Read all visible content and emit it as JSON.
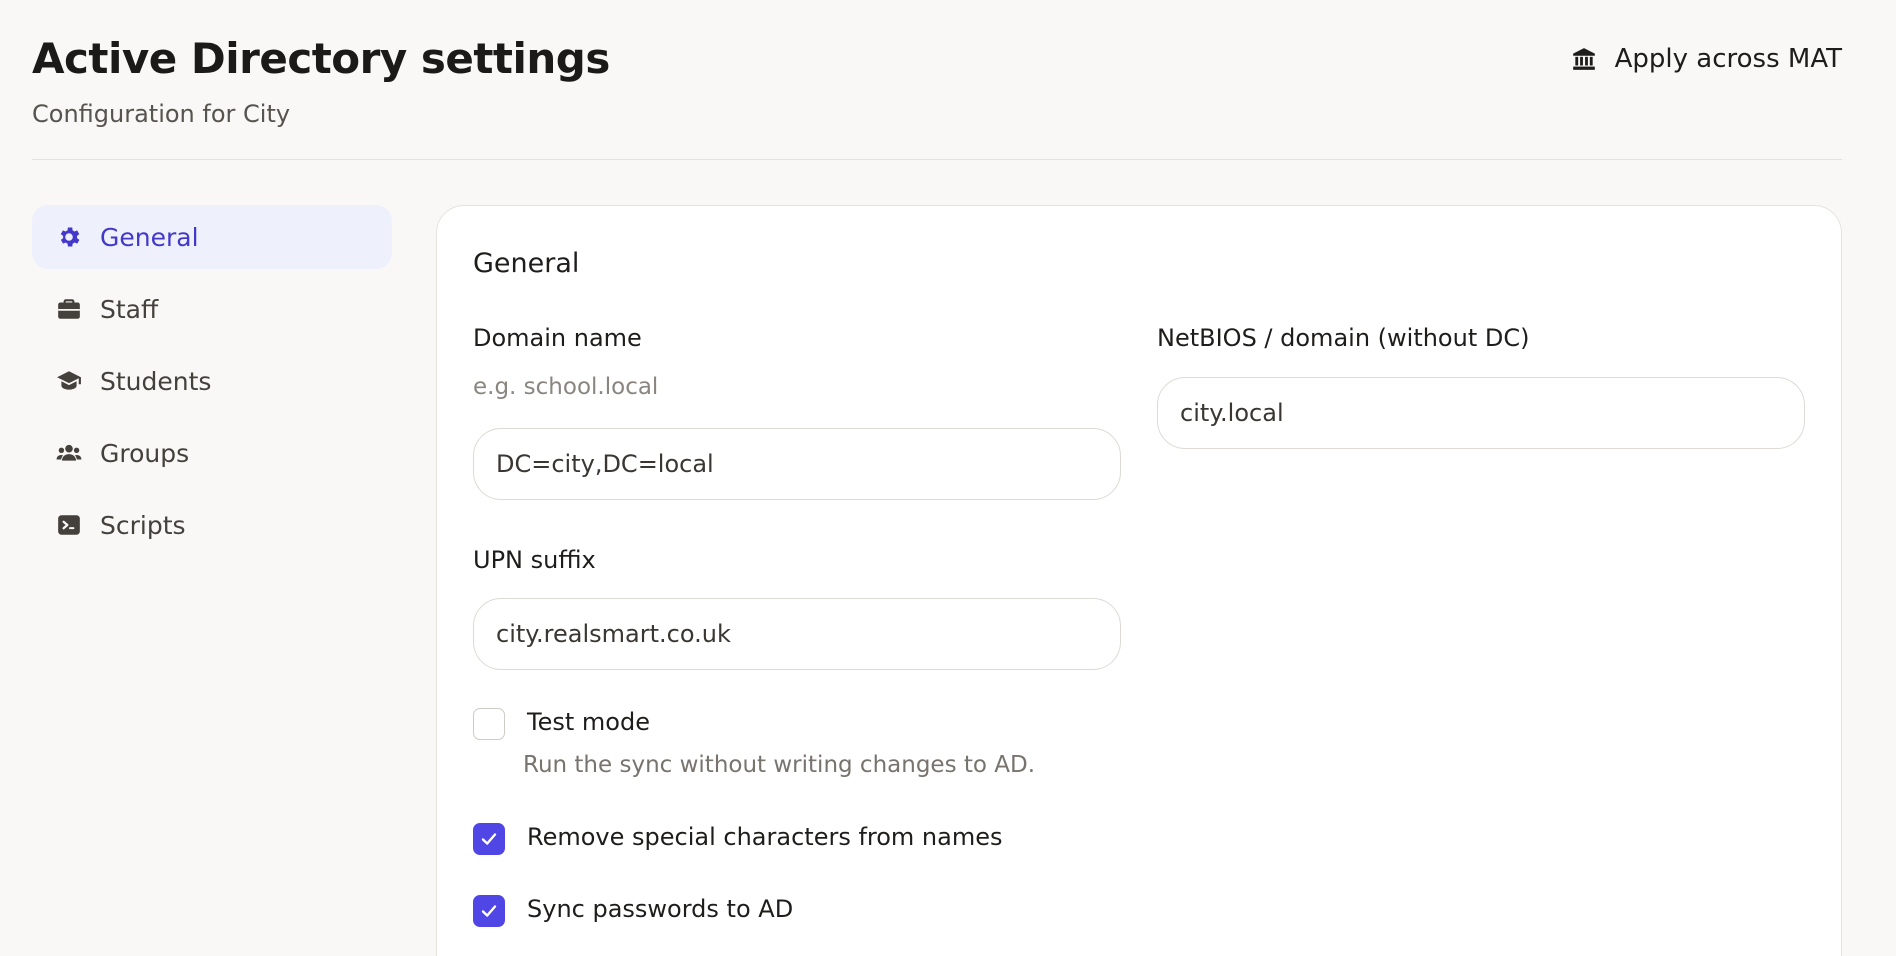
{
  "header": {
    "title": "Active Directory settings",
    "subtitle": "Configuration for City",
    "apply_label": "Apply across MAT",
    "apply_icon": "bank-icon"
  },
  "sidebar": {
    "accent_color": "#4338ca",
    "items": [
      {
        "label": "General",
        "icon": "gear-icon",
        "active": true
      },
      {
        "label": "Staff",
        "icon": "briefcase-icon",
        "active": false
      },
      {
        "label": "Students",
        "icon": "graduation-cap-icon",
        "active": false
      },
      {
        "label": "Groups",
        "icon": "users-icon",
        "active": false
      },
      {
        "label": "Scripts",
        "icon": "terminal-icon",
        "active": false
      }
    ]
  },
  "general": {
    "title": "General",
    "domain_name": {
      "label": "Domain name",
      "hint": "e.g. school.local",
      "value": "DC=city,DC=local"
    },
    "netbios": {
      "label": "NetBIOS / domain (without DC)",
      "value": "city.local"
    },
    "upn_suffix": {
      "label": "UPN suffix",
      "value": "city.realsmart.co.uk"
    },
    "test_mode": {
      "label": "Test mode",
      "description": "Run the sync without writing changes to AD.",
      "checked": false
    },
    "remove_special": {
      "label": "Remove special characters from names",
      "checked": true
    },
    "sync_passwords": {
      "label": "Sync passwords to AD",
      "checked": true
    },
    "checkbox_color": "#4f46e5"
  }
}
